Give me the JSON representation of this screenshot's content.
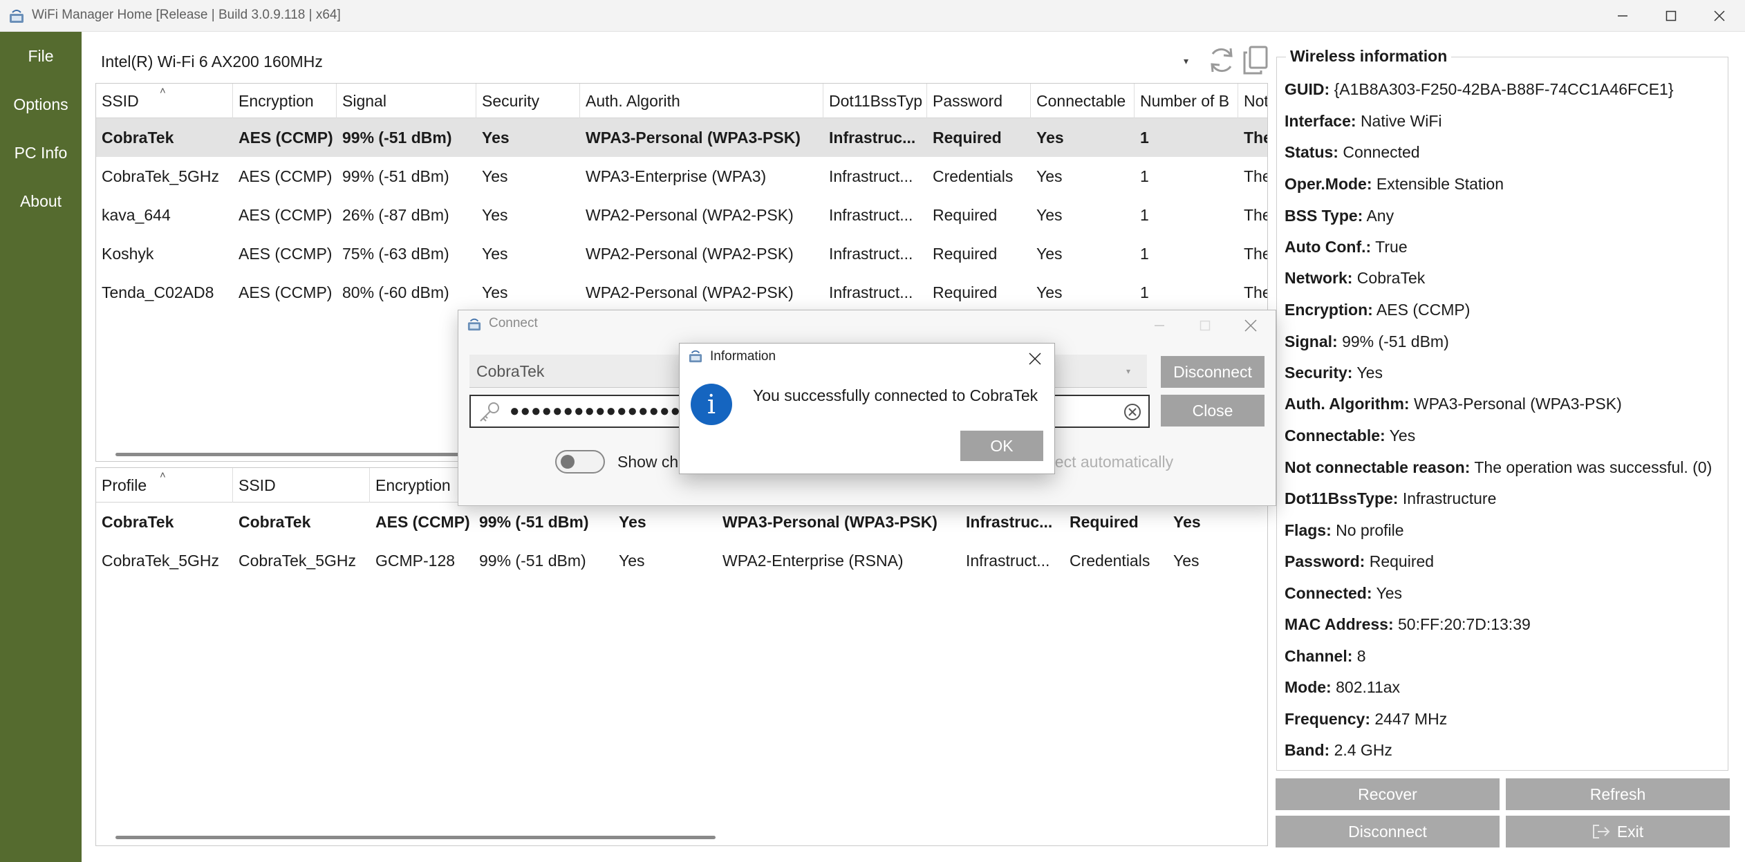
{
  "window": {
    "title": "WiFi Manager Home [Release | Build 3.0.9.118 | x64]"
  },
  "sidebar": {
    "items": [
      {
        "label": "File"
      },
      {
        "label": "Options"
      },
      {
        "label": "PC Info"
      },
      {
        "label": "About"
      }
    ],
    "color": "#556b2f"
  },
  "adapter": {
    "selected": "Intel(R) Wi-Fi 6 AX200 160MHz"
  },
  "networks_table": {
    "headers": [
      "SSID",
      "Encryption",
      "Signal",
      "Security",
      "Auth. Algorith",
      "Dot11BssTyp",
      "Password",
      "Connectable",
      "Number of B",
      "Not"
    ],
    "rows": [
      [
        "CobraTek",
        "AES (CCMP)",
        "99% (-51 dBm)",
        "Yes",
        "WPA3-Personal (WPA3-PSK)",
        "Infrastruc...",
        "Required",
        "Yes",
        "1",
        "The"
      ],
      [
        "CobraTek_5GHz",
        "AES (CCMP)",
        "99% (-51 dBm)",
        "Yes",
        "WPA3-Enterprise (WPA3)",
        "Infrastruct...",
        "Credentials",
        "Yes",
        "1",
        "The"
      ],
      [
        "kava_644",
        "AES (CCMP)",
        "26% (-87 dBm)",
        "Yes",
        "WPA2-Personal (WPA2-PSK)",
        "Infrastruct...",
        "Required",
        "Yes",
        "1",
        "The"
      ],
      [
        "Koshyk",
        "AES (CCMP)",
        "75% (-63 dBm)",
        "Yes",
        "WPA2-Personal (WPA2-PSK)",
        "Infrastruct...",
        "Required",
        "Yes",
        "1",
        "The"
      ],
      [
        "Tenda_C02AD8",
        "AES (CCMP)",
        "80% (-60 dBm)",
        "Yes",
        "WPA2-Personal (WPA2-PSK)",
        "Infrastruct...",
        "Required",
        "Yes",
        "1",
        "The"
      ]
    ]
  },
  "profiles_table": {
    "headers": [
      "Profile",
      "SSID",
      "Encryption"
    ],
    "rows": [
      [
        "CobraTek",
        "CobraTek",
        "AES (CCMP)",
        "99% (-51 dBm)",
        "Yes",
        "WPA3-Personal (WPA3-PSK)",
        "Infrastruc...",
        "Required",
        "Yes"
      ],
      [
        "CobraTek_5GHz",
        "CobraTek_5GHz",
        "GCMP-128",
        "99% (-51 dBm)",
        "Yes",
        "WPA2-Enterprise (RSNA)",
        "Infrastruct...",
        "Credentials",
        "Yes"
      ]
    ]
  },
  "wireless_info": {
    "title": "Wireless information",
    "rows": [
      {
        "key": "GUID:",
        "value": "{A1B8A303-F250-42BA-B88F-74CC1A46FCE1}"
      },
      {
        "key": "Interface:",
        "value": "Native WiFi"
      },
      {
        "key": "Status:",
        "value": "Connected"
      },
      {
        "key": "Oper.Mode:",
        "value": "Extensible Station"
      },
      {
        "key": "BSS Type:",
        "value": "Any"
      },
      {
        "key": "Auto Conf.:",
        "value": "True"
      },
      {
        "key": "Network:",
        "value": "CobraTek"
      },
      {
        "key": "Encryption:",
        "value": "AES (CCMP)"
      },
      {
        "key": "Signal:",
        "value": "99% (-51 dBm)"
      },
      {
        "key": "Security:",
        "value": "Yes"
      },
      {
        "key": "Auth. Algorithm:",
        "value": "WPA3-Personal (WPA3-PSK)"
      },
      {
        "key": "Connectable:",
        "value": "Yes"
      },
      {
        "key": "Not connectable reason:",
        "value": "The operation was successful. (0)"
      },
      {
        "key": "Dot11BssType:",
        "value": "Infrastructure"
      },
      {
        "key": "Flags:",
        "value": "No profile"
      },
      {
        "key": "Password:",
        "value": "Required"
      },
      {
        "key": "Connected:",
        "value": "Yes"
      },
      {
        "key": "MAC Address:",
        "value": "50:FF:20:7D:13:39"
      },
      {
        "key": "Channel:",
        "value": "8"
      },
      {
        "key": "Mode:",
        "value": "802.11ax"
      },
      {
        "key": "Frequency:",
        "value": "2447 MHz"
      },
      {
        "key": "Band:",
        "value": "2.4 GHz"
      }
    ]
  },
  "actions": {
    "recover": "Recover",
    "refresh": "Refresh",
    "disconnect": "Disconnect",
    "exit": "Exit"
  },
  "connect_dialog": {
    "title": "Connect",
    "ssid": "CobraTek",
    "password_mask": "●●●●●●●●●●●●●●●●●",
    "disconnect_label": "Disconnect",
    "close_label": "Close",
    "show_chars_label": "Show ch",
    "auto_label": "nect automatically"
  },
  "info_dialog": {
    "title": "Information",
    "message": "You successfully connected to CobraTek",
    "ok_label": "OK"
  }
}
